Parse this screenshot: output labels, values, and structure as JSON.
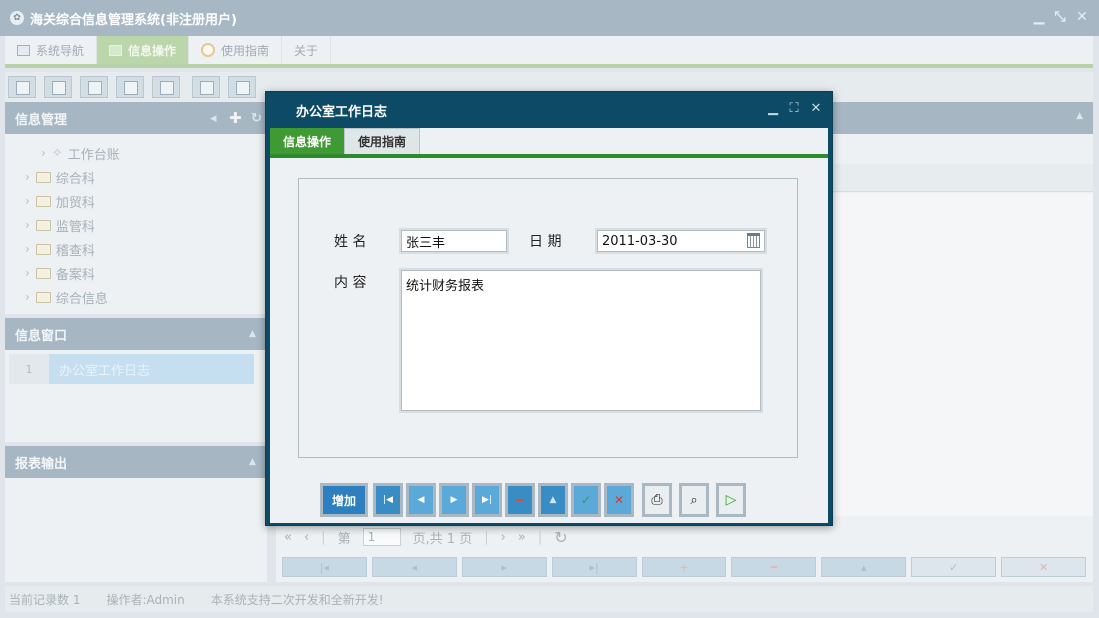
{
  "window": {
    "title": "海关综合信息管理系统(非注册用户)",
    "controls": {
      "minimize": "▁",
      "restore": "⤡",
      "close": "✕"
    }
  },
  "menubar": {
    "tabs": [
      {
        "label": "系统导航",
        "icon": "monitor-icon"
      },
      {
        "label": "信息操作",
        "icon": "grid-icon",
        "active": true
      },
      {
        "label": "使用指南",
        "icon": "clock-icon"
      },
      {
        "label": "关于",
        "icon": ""
      }
    ]
  },
  "left_panel": {
    "info_manage": {
      "title": "信息管理",
      "tree": [
        {
          "label": "工作台账",
          "icon": "wand-icon"
        },
        {
          "label": "综合科",
          "icon": "folder-icon"
        },
        {
          "label": "加贸科",
          "icon": "folder-icon"
        },
        {
          "label": "监管科",
          "icon": "folder-icon"
        },
        {
          "label": "稽查科",
          "icon": "folder-icon"
        },
        {
          "label": "备案科",
          "icon": "folder-icon"
        },
        {
          "label": "综合信息",
          "icon": "folder-icon"
        }
      ]
    },
    "info_window": {
      "title": "信息窗口",
      "rows": [
        {
          "num": "1",
          "label": "办公室工作日志"
        }
      ]
    },
    "report": {
      "title": "报表输出"
    }
  },
  "pager": {
    "page_prefix": "第",
    "page_value": "1",
    "page_suffix": "页,共 1 页"
  },
  "status": {
    "records": "当前记录数 1",
    "operator": "操作者:Admin",
    "note": "本系统支持二次开发和全新开发!"
  },
  "modal": {
    "title": "办公室工作日志",
    "tabs": [
      {
        "label": "信息操作",
        "active": true
      },
      {
        "label": "使用指南",
        "active": false
      }
    ],
    "form": {
      "name_label": "姓 名",
      "name_value": "张三丰",
      "date_label": "日 期",
      "date_value": "2011-03-30",
      "content_label": "内 容",
      "content_value": "统计财务报表"
    },
    "buttons": {
      "add_label": "增加"
    }
  },
  "colors": {
    "modal_frame": "#0d4a66",
    "tab_active": "#3f9a34",
    "button_blue": "#3a8cc4"
  }
}
